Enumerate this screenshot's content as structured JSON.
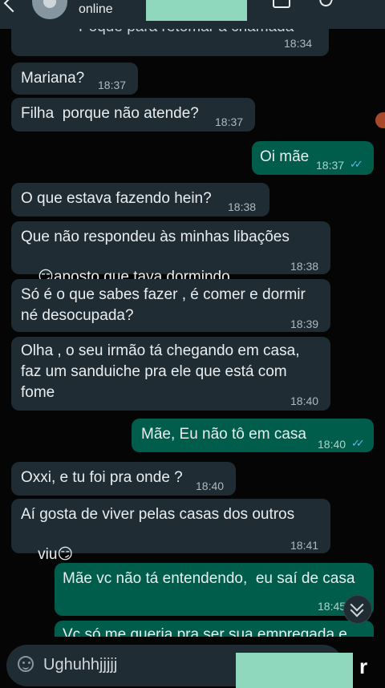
{
  "header": {
    "status": "online"
  },
  "messages": [
    {
      "dir": "in",
      "text": "Poque para retomar a chamada",
      "time": "18:34"
    },
    {
      "dir": "in",
      "text": "Mariana?",
      "time": "18:37"
    },
    {
      "dir": "in",
      "text": "Filha  porque não atende?",
      "time": "18:37"
    },
    {
      "dir": "out",
      "text": "Oi mãe",
      "time": "18:37"
    },
    {
      "dir": "in",
      "text": "O que estava fazendo hein?",
      "time": "18:38"
    },
    {
      "dir": "in",
      "line1": "Que não respondeu às minhas libações",
      "line2": "aposto que tava dormindo",
      "time": "18:38"
    },
    {
      "dir": "in",
      "line1": "Só é o que sabes fazer , é comer e dormir",
      "line2": "né desocupada?",
      "time": "18:39"
    },
    {
      "dir": "in",
      "line1": "Olha , o seu irmão tá chegando em casa,",
      "line2": "faz um sanduiche pra ele que está com",
      "line3": "fome",
      "time": "18:40"
    },
    {
      "dir": "out",
      "text": "Mãe, Eu não tô em casa",
      "time": "18:40"
    },
    {
      "dir": "in",
      "text": "Oxxi, e tu foi pra onde ?",
      "time": "18:40"
    },
    {
      "dir": "in",
      "line1": "Aí gosta de viver pelas casas dos outros",
      "line2": "viu",
      "time": "18:41"
    },
    {
      "dir": "out",
      "text": "Mãe vc não tá entendendo,  eu saí de casa",
      "time": "18:45"
    },
    {
      "dir": "out",
      "text": "Vc só me queria pra ser sua empregada e"
    }
  ],
  "composer": {
    "value": "Ughuhhjjjjj",
    "partial": "r"
  },
  "colors": {
    "incoming": "#1f2c34",
    "outgoing": "#005c4b",
    "read_ticks": "#53bdeb",
    "send": "#00a884"
  },
  "icons": [
    "back-arrow-icon",
    "avatar",
    "video-call-icon",
    "phone-icon",
    "menu-icon",
    "double-check-icon",
    "emoji-icon",
    "chevron-down-icon"
  ]
}
